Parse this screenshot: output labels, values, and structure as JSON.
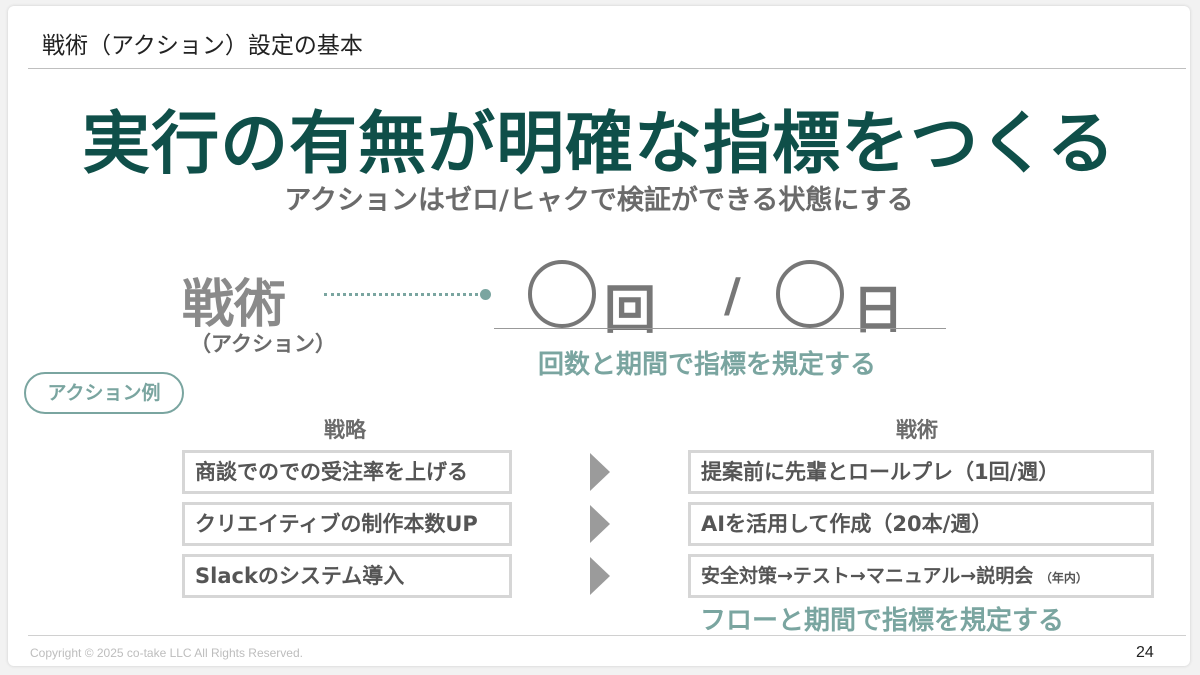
{
  "header": {
    "title": "戦術（アクション）設定の基本"
  },
  "main": {
    "title": "実行の有無が明確な指標をつくる",
    "subtitle": "アクションはゼロ/ヒャクで検証ができる状態にする"
  },
  "formula": {
    "label": "戦術",
    "label_sub": "（アクション）",
    "count_unit": "回",
    "slash": "/",
    "period_unit": "日",
    "caption": "回数と期間で指標を規定する"
  },
  "examples": {
    "pill_label": "アクション例",
    "strategy_header": "戦略",
    "tactics_header": "戦術",
    "rows": [
      {
        "strategy": "商談でのでの受注率を上げる",
        "tactic": "提案前に先輩とロールプレ（1回/週）",
        "tactic_note": ""
      },
      {
        "strategy": "クリエイティブの制作本数UP",
        "tactic": "AIを活用して作成（20本/週）",
        "tactic_note": ""
      },
      {
        "strategy": "Slackのシステム導入",
        "tactic": "安全対策→テスト→マニュアル→説明会",
        "tactic_note": "（年内）"
      }
    ],
    "bottom_caption": "フローと期間で指標を規定する"
  },
  "footer": {
    "copyright": "Copyright © 2025 co-take LLC All Rights Reserved.",
    "page_number": "24"
  },
  "colors": {
    "title_green": "#0f4f49",
    "accent_teal": "#7aa5a0",
    "gray_text": "#6b6b6b"
  }
}
